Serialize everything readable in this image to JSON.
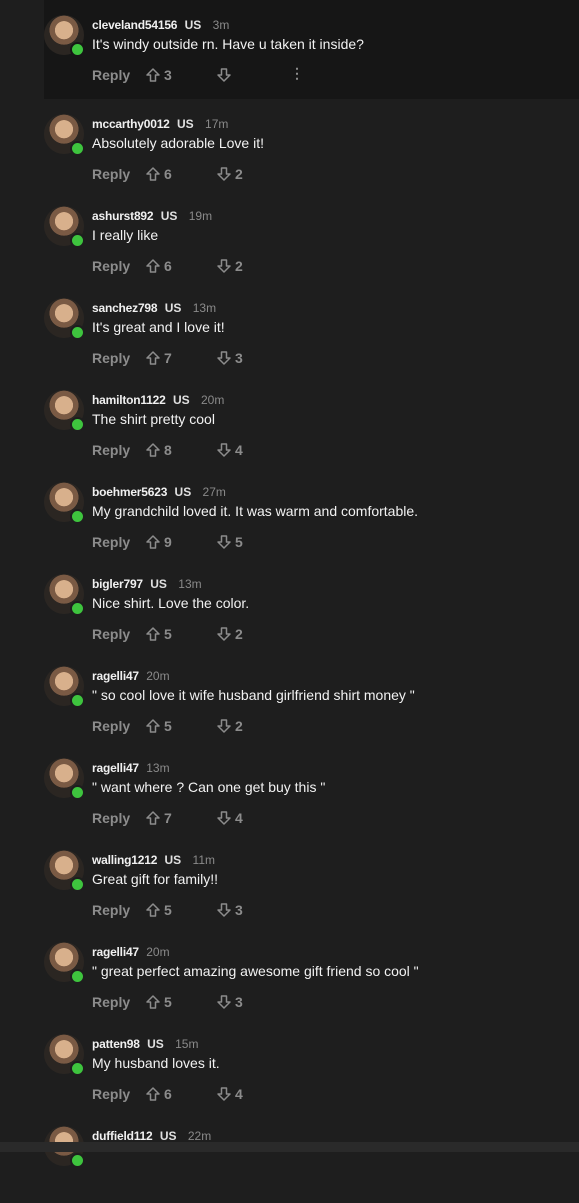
{
  "reply_label": "Reply",
  "more_label": "⋮",
  "comments": [
    {
      "user": "cleveland54156",
      "country": "US",
      "time": "3m",
      "text": "It's windy outside rn. Have u taken it inside?",
      "up": "3",
      "down": ""
    },
    {
      "user": "mccarthy0012",
      "country": "US",
      "time": "17m",
      "text": "Absolutely adorable Love it!",
      "up": "6",
      "down": "2"
    },
    {
      "user": "ashurst892",
      "country": "US",
      "time": "19m",
      "text": "I really like",
      "up": "6",
      "down": "2"
    },
    {
      "user": "sanchez798",
      "country": "US",
      "time": "13m",
      "text": "It's great and I love it!",
      "up": "7",
      "down": "3"
    },
    {
      "user": "hamilton1122",
      "country": "US",
      "time": "20m",
      "text": "The shirt pretty cool",
      "up": "8",
      "down": "4"
    },
    {
      "user": "boehmer5623",
      "country": "US",
      "time": "27m",
      "text": "My grandchild loved it. It was warm and comfortable.",
      "up": "9",
      "down": "5"
    },
    {
      "user": "bigler797",
      "country": "US",
      "time": "13m",
      "text": "Nice shirt. Love the color.",
      "up": "5",
      "down": "2"
    },
    {
      "user": "ragelli47",
      "country": "",
      "time": "20m",
      "text": "\" so cool love it wife husband girlfriend shirt money \"",
      "up": "5",
      "down": "2"
    },
    {
      "user": "ragelli47",
      "country": "",
      "time": "13m",
      "text": "\" want where ? Can one get buy this \"",
      "up": "7",
      "down": "4"
    },
    {
      "user": "walling1212",
      "country": "US",
      "time": "11m",
      "text": "Great gift for family!!",
      "up": "5",
      "down": "3"
    },
    {
      "user": "ragelli47",
      "country": "",
      "time": "20m",
      "text": "\" great perfect amazing awesome gift friend so cool \"",
      "up": "5",
      "down": "3"
    },
    {
      "user": "patten98",
      "country": "US",
      "time": "15m",
      "text": "My husband loves it.",
      "up": "6",
      "down": "4"
    },
    {
      "user": "duffield112",
      "country": "US",
      "time": "22m",
      "text": "",
      "up": "",
      "down": ""
    }
  ]
}
